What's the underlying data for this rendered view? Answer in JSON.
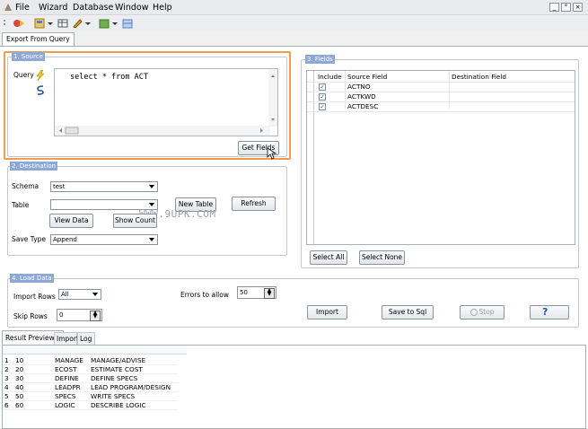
{
  "menu": [
    "File",
    "Wizard",
    "Database",
    "Window",
    "Help"
  ],
  "window_controls": [
    "_",
    "°",
    "×"
  ],
  "main_tab": "Export From Query",
  "source": {
    "legend": "1. Source",
    "query_label": "Query",
    "query_text": "select * from ACT",
    "get_fields_label": "Get Fields"
  },
  "destination": {
    "legend": "2. Destination",
    "schema_label": "Schema",
    "schema_value": "test",
    "table_label": "Table",
    "table_value": "",
    "new_table_label": "New Table",
    "refresh_label": "Refresh",
    "view_data_label": "View Data",
    "show_count_label": "Show Count",
    "save_type_label": "Save Type",
    "save_type_value": "Append"
  },
  "watermark": "WWW.9UPK.COM",
  "fields": {
    "legend": "3. Fields",
    "columns": [
      "Include",
      "Source Field",
      "Destination Field"
    ],
    "rows": [
      {
        "include": "✓",
        "source": "ACTNO",
        "dest": ""
      },
      {
        "include": "✓",
        "source": "ACTKWD",
        "dest": ""
      },
      {
        "include": "✓",
        "source": "ACTDESC",
        "dest": ""
      }
    ],
    "select_all_label": "Select All",
    "select_none_label": "Select None"
  },
  "load": {
    "legend": "4. Load Data",
    "import_rows_label": "Import Rows",
    "import_rows_value": "All",
    "skip_rows_label": "Skip Rows",
    "skip_rows_value": "0",
    "errors_label": "Errors to allow",
    "errors_value": "50"
  },
  "actions": {
    "import_label": "Import",
    "save_sql_label": "Save to Sql",
    "stop_label": "Stop"
  },
  "bottom_tabs": [
    "Result Preview",
    "Import",
    "Log"
  ],
  "results": [
    [
      "1",
      "10",
      "MANAGE",
      "MANAGE/ADVISE"
    ],
    [
      "2",
      "20",
      "ECOST",
      "ESTIMATE COST"
    ],
    [
      "3",
      "30",
      "DEFINE",
      "DEFINE SPECS"
    ],
    [
      "4",
      "40",
      "LEADPR",
      "LEAD PROGRAM/DESIGN"
    ],
    [
      "5",
      "50",
      "SPECS",
      "WRITE SPECS"
    ],
    [
      "6",
      "60",
      "LOGIC",
      "DESCRIBE LOGIC"
    ]
  ],
  "accent_colors": {
    "source_highlight": "#f29a4e",
    "legend_bg": "#8ea8d6"
  }
}
